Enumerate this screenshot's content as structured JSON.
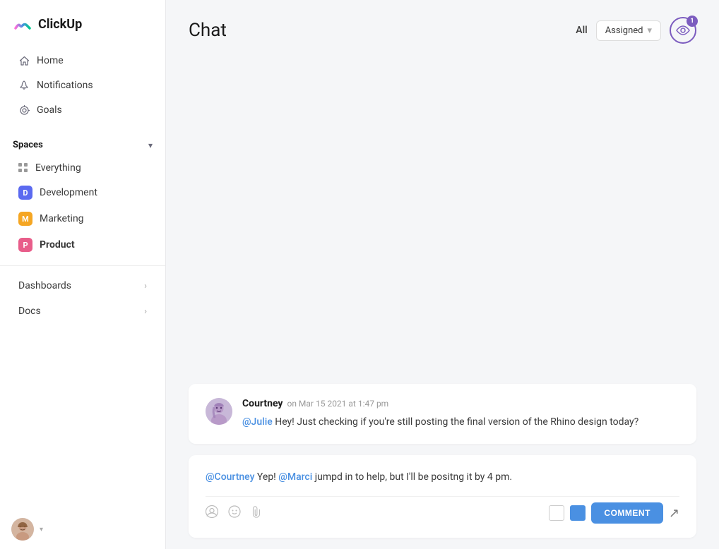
{
  "sidebar": {
    "logo_text": "ClickUp",
    "nav": [
      {
        "id": "home",
        "label": "Home",
        "icon": "home"
      },
      {
        "id": "notifications",
        "label": "Notifications",
        "icon": "bell"
      },
      {
        "id": "goals",
        "label": "Goals",
        "icon": "trophy"
      }
    ],
    "spaces_label": "Spaces",
    "spaces": [
      {
        "id": "everything",
        "label": "Everything",
        "type": "grid"
      },
      {
        "id": "development",
        "label": "Development",
        "type": "badge",
        "color": "#5b6af0",
        "letter": "D"
      },
      {
        "id": "marketing",
        "label": "Marketing",
        "type": "badge",
        "color": "#f5a623",
        "letter": "M"
      },
      {
        "id": "product",
        "label": "Product",
        "type": "badge",
        "color": "#e85d8a",
        "letter": "P",
        "active": true
      }
    ],
    "bottom_items": [
      {
        "id": "dashboards",
        "label": "Dashboards"
      },
      {
        "id": "docs",
        "label": "Docs"
      }
    ]
  },
  "header": {
    "title": "Chat",
    "filter_all": "All",
    "filter_assigned": "Assigned",
    "eye_count": "1"
  },
  "messages": [
    {
      "id": "msg1",
      "author": "Courtney",
      "time": "on Mar 15 2021 at 1:47 pm",
      "mention": "@Julie",
      "text": " Hey! Just checking if you're still posting the final version of the Rhino design today?"
    }
  ],
  "reply": {
    "mention1": "@Courtney",
    "text1": " Yep! ",
    "mention2": "@Marci",
    "text2": " jumpd in to help, but I'll be positng it by 4 pm.",
    "comment_label": "COMMENT"
  }
}
